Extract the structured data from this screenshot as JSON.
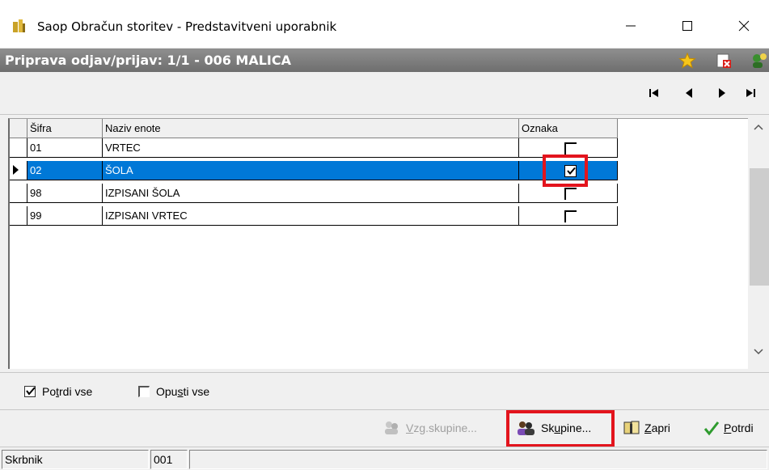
{
  "window": {
    "title": "Saop Obračun storitev - Predstavitveni uporabnik"
  },
  "header": {
    "title": "Priprava odjav/prijav: 1/1 - 006 MALICA",
    "icons": [
      "star-icon",
      "document-delete-icon",
      "user-help-icon"
    ]
  },
  "nav": {
    "icons": [
      "first-record-icon",
      "previous-record-icon",
      "next-record-icon",
      "last-record-icon"
    ]
  },
  "grid": {
    "columns": [
      "Šifra",
      "Naziv enote",
      "Oznaka"
    ],
    "rows": [
      {
        "sifra": "01",
        "naziv": "VRTEC",
        "checked": false,
        "selected": false
      },
      {
        "sifra": "02",
        "naziv": "ŠOLA",
        "checked": true,
        "selected": true
      },
      {
        "sifra": "98",
        "naziv": "IZPISANI ŠOLA",
        "checked": false,
        "selected": false
      },
      {
        "sifra": "99",
        "naziv": "IZPISANI VRTEC",
        "checked": false,
        "selected": false
      }
    ]
  },
  "options": {
    "confirm_all": {
      "label_pre": "Po",
      "label_acc": "t",
      "label_post": "rdi vse",
      "checked": true
    },
    "discard_all": {
      "label_pre": "Opu",
      "label_acc": "s",
      "label_post": "ti vse",
      "checked": false
    }
  },
  "buttons": {
    "vzg_groups": {
      "label_pre": "",
      "label_acc": "V",
      "label_post": "zg.skupine...",
      "enabled": false
    },
    "groups": {
      "label_pre": "Sk",
      "label_acc": "u",
      "label_post": "pine...",
      "enabled": true
    },
    "close": {
      "label_pre": "",
      "label_acc": "Z",
      "label_post": "apri",
      "enabled": true
    },
    "confirm": {
      "label_pre": "",
      "label_acc": "P",
      "label_post": "otrdi",
      "enabled": true
    }
  },
  "status": {
    "label": "Skrbnik",
    "value": "001",
    "extra": ""
  },
  "colors": {
    "selection": "#0078d7",
    "highlight": "#e3141d",
    "header_band": "#7d7d7d"
  }
}
